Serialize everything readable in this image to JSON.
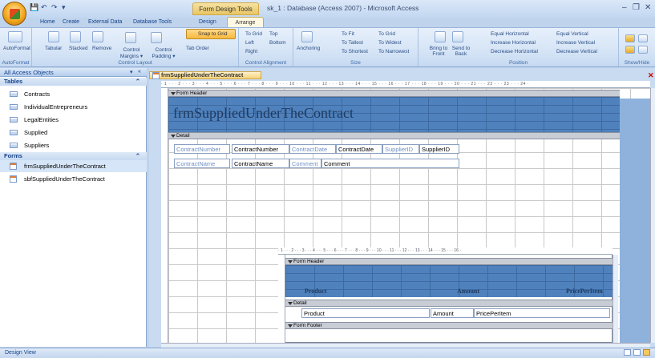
{
  "window": {
    "context_tab": "Form Design Tools",
    "title": "sk_1 : Database (Access 2007) - Microsoft Access",
    "minimize": "–",
    "restore": "❐",
    "close": "✕"
  },
  "qat": {
    "save": "💾",
    "undo": "↶",
    "redo": "↷",
    "customize": "▾"
  },
  "tabs": [
    "Home",
    "Create",
    "External Data",
    "Database Tools",
    "Design",
    "Arrange"
  ],
  "ribbon": {
    "groups": [
      {
        "label": "AutoFormat",
        "items": [
          "AutoFormat"
        ]
      },
      {
        "label": "Control Layout",
        "items": [
          "Tabular",
          "Stacked",
          "Remove",
          "Control Margins ▾",
          "Control Padding ▾",
          "Snap to Grid",
          "Tab Order"
        ]
      },
      {
        "label": "Control Alignment",
        "items": [
          "To Grid",
          "Top",
          "Left",
          "Bottom",
          "Right"
        ]
      },
      {
        "label": "Size",
        "items": [
          "Anchoring",
          "To Fit",
          "To Grid",
          "To Tallest",
          "To Widest",
          "To Shortest",
          "To Narrowest"
        ]
      },
      {
        "label": "Position",
        "items": [
          "Bring to Front",
          "Send to Back",
          "Equal Horizontal",
          "Increase Horizontal",
          "Decrease Horizontal",
          "Equal Vertical",
          "Increase Vertical",
          "Decrease Vertical"
        ]
      },
      {
        "label": "Show/Hide",
        "items": []
      }
    ]
  },
  "nav": {
    "header": "All Access Objects",
    "sections": [
      {
        "title": "Tables",
        "items": [
          "Contracts",
          "IndividualEntrepreneurs",
          "LegalEntities",
          "Supplied",
          "Suppliers"
        ]
      },
      {
        "title": "Forms",
        "items": [
          "frmSuppliedUnderTheContract",
          "sbfSuppliedUnderTheContract"
        ]
      }
    ],
    "collapse": "«",
    "dropdown": "▾",
    "section_toggle": "⌃"
  },
  "document": {
    "tab": "frmSuppliedUnderTheContract",
    "ruler": "· 1 · · · 2 · · · 3 · · · 4 · · · 5 · · · 6 · · · 7 · · · 8 · · · 9 · · · 10 · · · 11 · · · 12 · · · 13 · · · 14 · · · 15 · · · 16 · · · 17 · · · 18 · · · 19 · · · 20 · · · 21 · · · 22 · · · 23 · · · 24 ·",
    "form_header": "Form Header",
    "title": "frmSuppliedUnderTheContract",
    "detail": "Detail",
    "controls_row1": [
      {
        "label": "ContractNumber",
        "field": "ContractNumber"
      },
      {
        "label": "ContractDate",
        "field": "ContractDate"
      },
      {
        "label": "SupplierID",
        "field": "SupplierID"
      }
    ],
    "controls_row2": [
      {
        "label": "ContractName",
        "field": "ContractName"
      },
      {
        "label": "Comment",
        "field": "Comment"
      }
    ]
  },
  "subform": {
    "ruler": "· 1 · · · 2 · · · 3 · · · 4 · · · 5 · · · 6 · · · 7 · · · 8 · · · 9 · · · 10 · · · 11 · · · 12 · · · 13 · · · 14 · · · 15 · · · 16 ·",
    "form_header": "Form Header",
    "headers": [
      "Product",
      "Amount",
      "PricePerItem"
    ],
    "detail": "Detail",
    "fields": [
      "Product",
      "Amount",
      "PricePerItem"
    ],
    "form_footer": "Form Footer"
  },
  "status": {
    "text": "Design View"
  }
}
